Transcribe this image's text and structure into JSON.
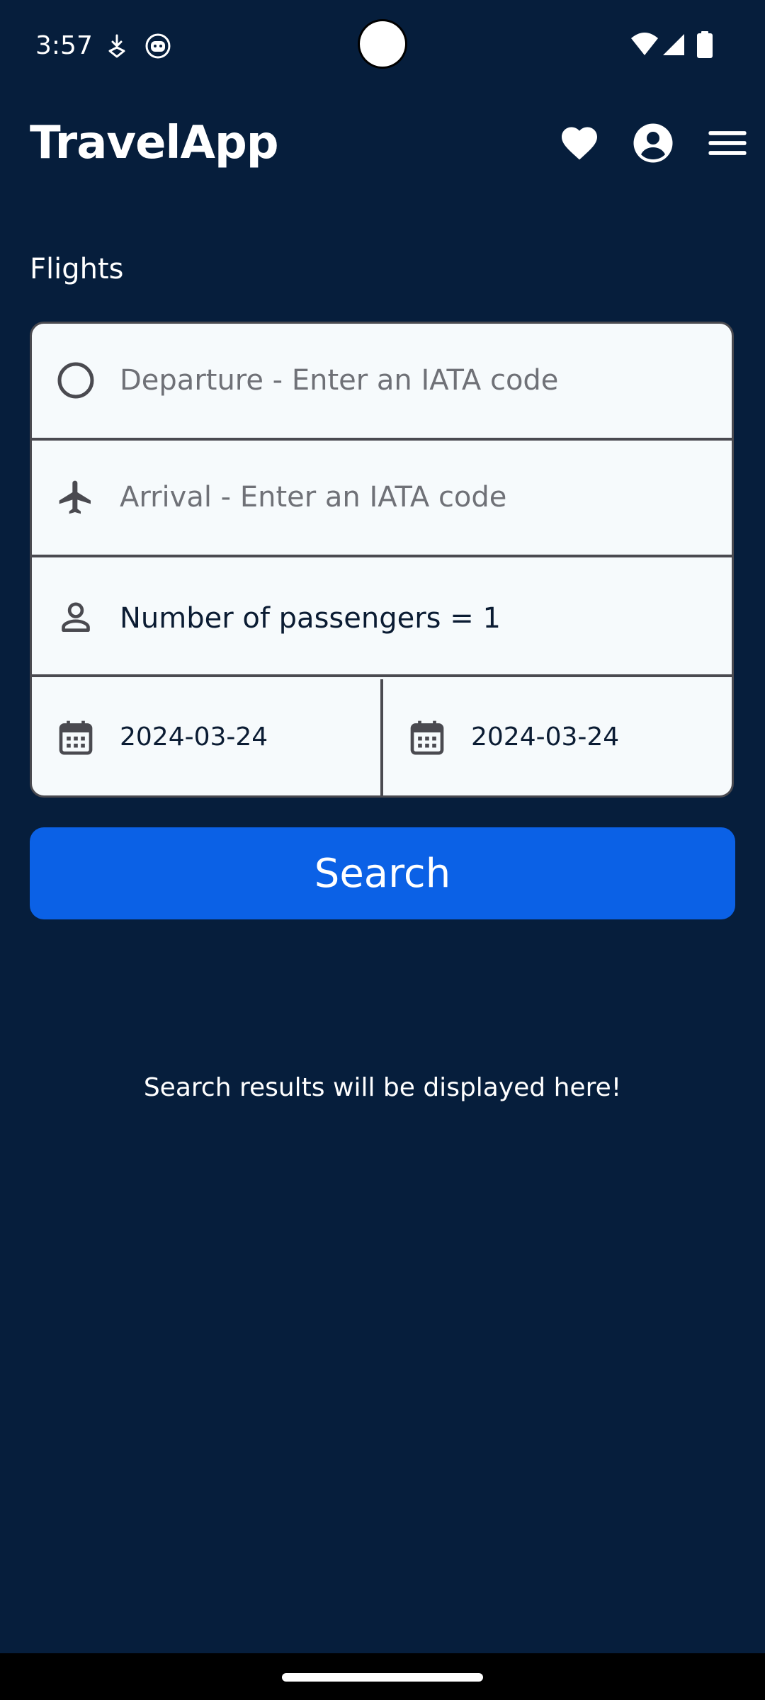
{
  "status_bar": {
    "time": "3:57",
    "icons": [
      "download-badge-icon",
      "android-robot-icon",
      "wifi-icon",
      "cellular-signal-icon",
      "battery-icon"
    ]
  },
  "header": {
    "title": "TravelApp",
    "icons": [
      "heart-icon",
      "account-circle-icon",
      "menu-icon"
    ]
  },
  "flights": {
    "section_label": "Flights",
    "departure": {
      "placeholder": "Departure - Enter an IATA code",
      "value": "",
      "icon": "circle-outline-icon"
    },
    "arrival": {
      "placeholder": "Arrival - Enter an IATA code",
      "value": "",
      "icon": "airplane-icon"
    },
    "passengers": {
      "text": "Number of passengers = 1",
      "icon": "person-icon"
    },
    "date_from": {
      "value": "2024-03-24",
      "icon": "calendar-icon"
    },
    "date_to": {
      "value": "2024-03-24",
      "icon": "calendar-icon"
    },
    "search_label": "Search"
  },
  "results": {
    "placeholder": "Search results will be displayed here!"
  },
  "colors": {
    "background": "#061e3c",
    "card": "#f6fafc",
    "border": "#4a4a50",
    "primary_button": "#0b61e6",
    "text_dark": "#0b1c33",
    "placeholder_text": "#6f7177"
  }
}
